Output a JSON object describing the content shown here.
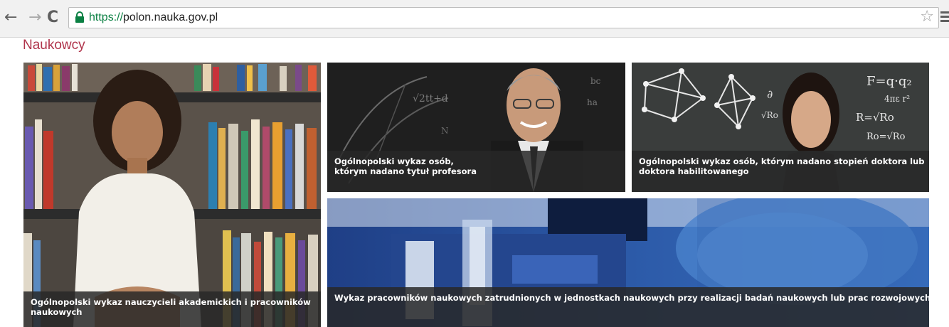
{
  "browser": {
    "url_scheme": "https://",
    "url_host": "polon.nauka.gov.pl",
    "icons": [
      "back-arrow-icon",
      "forward-arrow-icon",
      "reload-icon",
      "lock-icon",
      "star-icon",
      "menu-icon"
    ]
  },
  "page": {
    "section_title": "Naukowcy",
    "accent_color": "#b0344b"
  },
  "tiles": [
    {
      "id": "teachers",
      "lines": [
        "Ogólnopolski wykaz nauczycieli akademickich i pracowników",
        "naukowych"
      ]
    },
    {
      "id": "professor",
      "lines": [
        "Ogólnopolski wykaz osób,",
        "którym nadano tytuł profesora"
      ]
    },
    {
      "id": "doctor",
      "lines": [
        "Ogólnopolski wykaz osób, którym nadano stopień doktora lub",
        "doktora habilitowanego"
      ]
    },
    {
      "id": "researchers",
      "lines": [
        "Wykaz pracowników naukowych zatrudnionych w jednostkach naukowych przy realizacji badań naukowych lub prac rozwojowych"
      ]
    }
  ]
}
